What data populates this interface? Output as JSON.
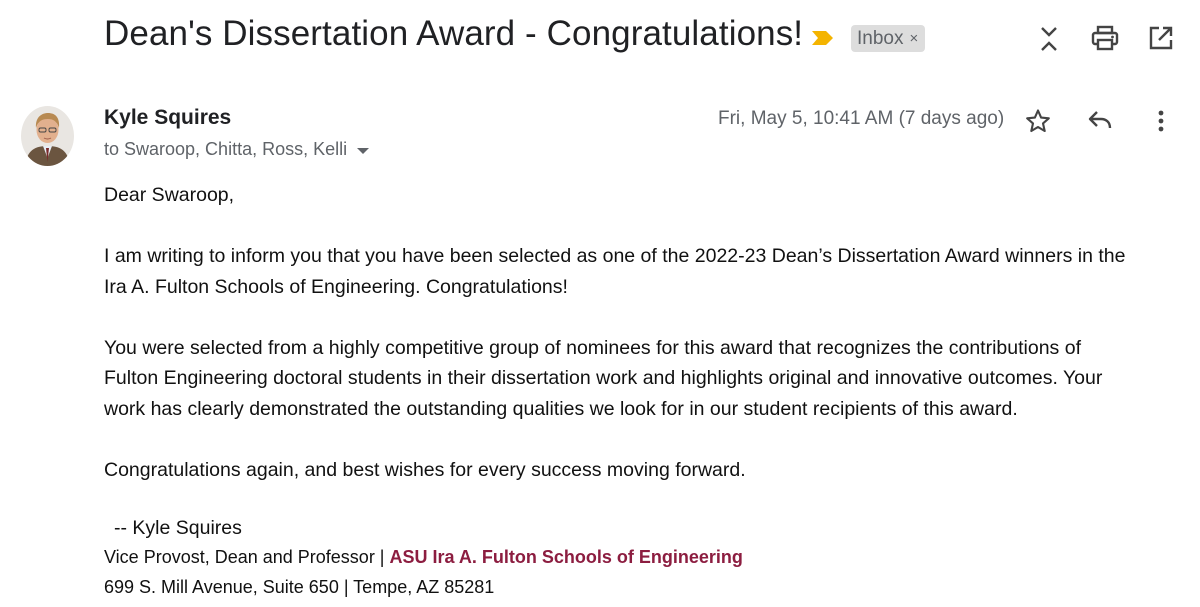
{
  "email": {
    "subject": "Dean's Dissertation Award - Congratulations!",
    "label": "Inbox",
    "label_close": "×",
    "sender": {
      "name": "Kyle Squires",
      "recipients": "to Swaroop, Chitta, Ross, Kelli"
    },
    "date": "Fri, May 5, 10:41 AM (7 days ago)",
    "body": {
      "greeting": "Dear Swaroop,",
      "paragraph1_line1": "I am writing to inform you that you have been selected as one of the 2022-23 Dean’s Dissertation Award winners in the",
      "paragraph1_line2": "Ira A. Fulton Schools of Engineering. Congratulations!",
      "paragraph2_line1": "You were selected from a highly competitive group of nominees for this award that recognizes the contributions of",
      "paragraph2_line2": "Fulton Engineering doctoral students in their dissertation work and highlights original and innovative outcomes. Your",
      "paragraph2_line3": "work has clearly demonstrated the outstanding qualities we look for in our student recipients of this award.",
      "closing": "Congratulations again, and best wishes for every success moving forward."
    },
    "signature": {
      "name_line": "-- Kyle Squires",
      "title": "Vice Provost, Dean and Professor | ",
      "org": "ASU Ira A. Fulton Schools of Engineering",
      "address": "699 S. Mill Avenue, Suite 650 | Tempe, AZ 85281"
    }
  },
  "icons": {
    "important": "important-marker-icon",
    "collapse": "collapse-icon",
    "print": "print-icon",
    "open_new": "open-in-new-window-icon",
    "star": "star-icon",
    "reply": "reply-icon",
    "more": "more-vert-icon"
  },
  "colors": {
    "important_marker": "#f4b400",
    "org_link": "#8c1d40",
    "label_chip_bg": "#dddddd"
  }
}
